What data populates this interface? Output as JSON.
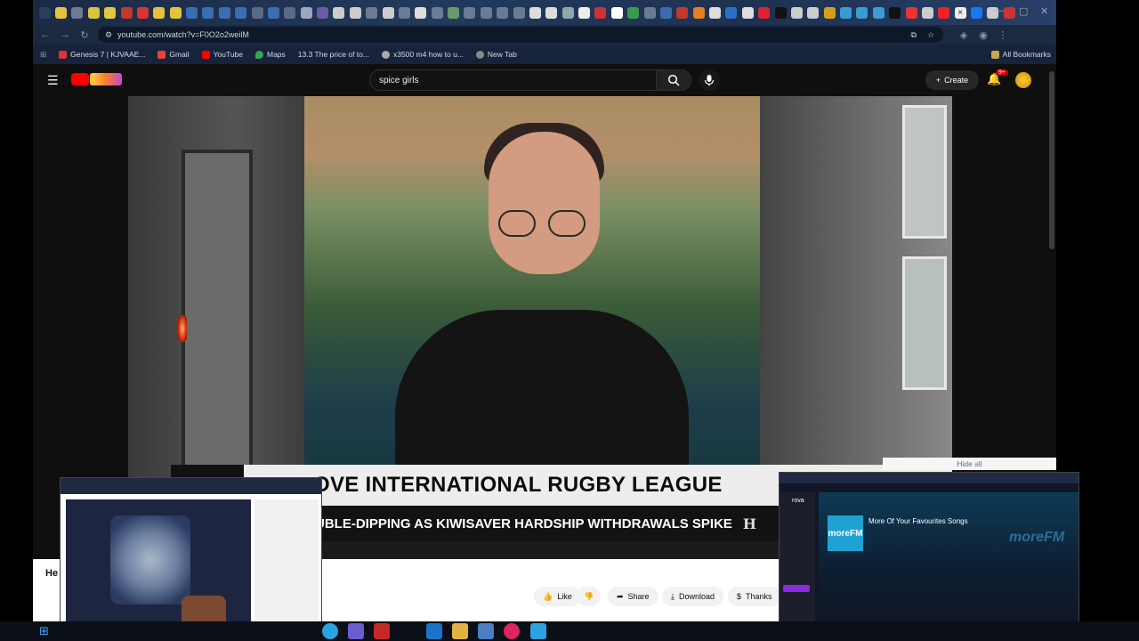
{
  "browser": {
    "url": "youtube.com/watch?v=F0O2o2weilM",
    "bookmarks": [
      {
        "label": "Genesis 7 | KJVAAE...",
        "color": "#d33"
      },
      {
        "label": "Gmail",
        "color": "#ea4335"
      },
      {
        "label": "YouTube",
        "color": "#ff0000"
      },
      {
        "label": "Maps",
        "color": "#34a853"
      },
      {
        "label": "13.3 The price of to...",
        "color": "#888"
      },
      {
        "label": "x3500 m4 how to u...",
        "color": "#aaa"
      },
      {
        "label": "New Tab",
        "color": "#888"
      }
    ],
    "all_bookmarks": "All Bookmarks"
  },
  "youtube": {
    "search_query": "spice girls",
    "create_label": "Create",
    "notif_badge": "9+",
    "actions": {
      "like": "Like",
      "share": "Share",
      "download": "Download",
      "thanks": "Thanks"
    },
    "below_partial": "He"
  },
  "video": {
    "lower_third": "OVE INTERNATIONAL RUGBY LEAGUE",
    "ticker": "UBLE-DIPPING AS KIWISAVER HARDSHIP WITHDRAWALS SPIKE",
    "brand_mark": "H"
  },
  "overlay": {
    "hide_all": "Hide all"
  },
  "thumb_radio": {
    "app": "rova",
    "title": "More Of Your Favourites Songs",
    "logo": "moreFM",
    "art_label": "moreFM"
  }
}
